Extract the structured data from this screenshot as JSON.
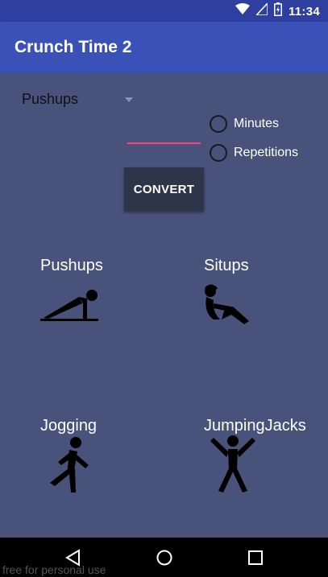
{
  "status_bar": {
    "time": "11:34",
    "icons": [
      "wifi-icon",
      "signal-icon",
      "battery-charging-icon"
    ]
  },
  "app_bar": {
    "title": "Crunch Time 2"
  },
  "converter": {
    "exercise_select": "Pushups",
    "value_input": "",
    "unit_options": [
      "Minutes",
      "Repetitions"
    ],
    "convert_label": "CONVERT"
  },
  "exercises": [
    {
      "label": "Pushups",
      "icon": "pushups-icon"
    },
    {
      "label": "Situps",
      "icon": "situps-icon"
    },
    {
      "label": "Jogging",
      "icon": "jogging-icon"
    },
    {
      "label": "JumpingJacks",
      "icon": "jumping-jacks-icon"
    }
  ],
  "nav_bar": {
    "buttons": [
      "back-icon",
      "home-icon",
      "recents-icon"
    ]
  },
  "watermark": "free for personal use",
  "colors": {
    "status_bar": "#2f3fa0",
    "app_bar": "#3a52b8",
    "background": "#48527a",
    "accent": "#ff4081",
    "button": "#2f3548"
  }
}
